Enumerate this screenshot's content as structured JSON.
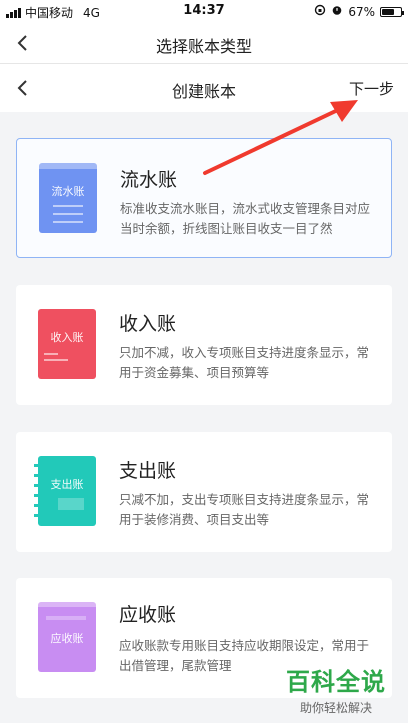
{
  "status_bar": {
    "carrier": "中国移动",
    "network": "4G",
    "time": "14:37",
    "battery": "67%",
    "battery_level": 0.67
  },
  "header": {
    "title": "选择账本类型"
  },
  "subheader": {
    "title": "创建账本",
    "next_label": "下一步"
  },
  "ledger_types": [
    {
      "name": "流水账",
      "icon_label": "流水账",
      "description": "标准收支流水账目，流水式收支管理条目对应当时余额，折线图让账目收支一目了然",
      "color": "#6f93f2"
    },
    {
      "name": "收入账",
      "icon_label": "收入账",
      "description": "只加不减，收入专项账目支持进度条显示，常用于资金募集、项目预算等",
      "color": "#ef5060"
    },
    {
      "name": "支出账",
      "icon_label": "支出账",
      "description": "只减不加，支出专项账目支持进度条显示，常用于装修消费、项目支出等",
      "color": "#22c9b9"
    },
    {
      "name": "应收账",
      "icon_label": "应收账",
      "description": "应收账款专用账目支持应收期限设定，常用于出借管理，尾款管理",
      "color": "#c88df2"
    }
  ],
  "watermark": {
    "title": "百科全说",
    "subtitle": "助你轻松解决"
  }
}
